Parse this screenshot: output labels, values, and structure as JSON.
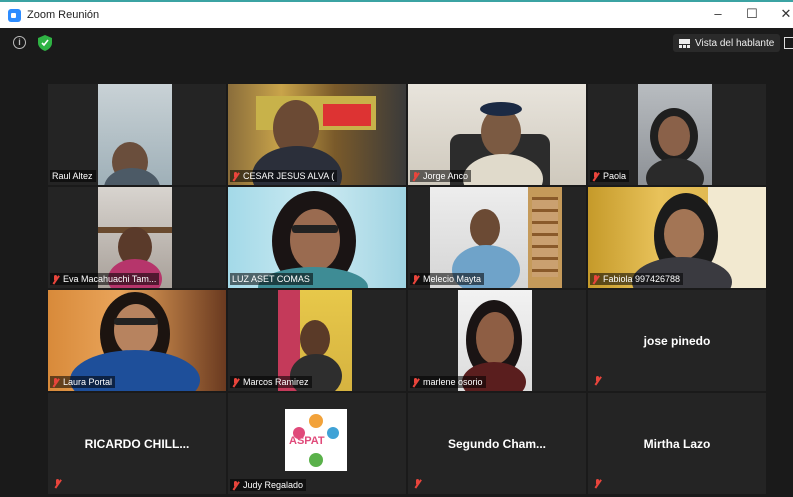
{
  "window": {
    "title": "Zoom Reunión",
    "minimize": "–",
    "maximize": "☐",
    "close": "✕"
  },
  "toolbar": {
    "view_button": "Vista del hablante"
  },
  "participants": [
    {
      "name": "Raul Altez",
      "muted": false
    },
    {
      "name": "CESAR JESUS ALVA (",
      "muted": true
    },
    {
      "name": "Jorge Anco",
      "muted": true
    },
    {
      "name": "Paola",
      "muted": true
    },
    {
      "name": "Eva Macahuachi Tam...",
      "muted": true
    },
    {
      "name": "LUZ ASET COMAS",
      "muted": false,
      "active_speaker": true
    },
    {
      "name": "Melecio Mayta",
      "muted": true
    },
    {
      "name": "Fabiola 997426788",
      "muted": true
    },
    {
      "name": "Laura Portal",
      "muted": true
    },
    {
      "name": "Marcos Ramirez",
      "muted": true
    },
    {
      "name": "marlene osorio",
      "muted": true
    },
    {
      "name": "jose pinedo",
      "muted": true,
      "video_off": true
    },
    {
      "name": "RICARDO CHILL...",
      "muted": true,
      "video_off": true
    },
    {
      "name": "Judy Regalado",
      "muted": true
    },
    {
      "name": "Segundo  Cham...",
      "muted": true,
      "video_off": true
    },
    {
      "name": "Mirtha Lazo",
      "muted": true,
      "video_off": true
    }
  ],
  "logo": {
    "text": "ASPAT"
  }
}
